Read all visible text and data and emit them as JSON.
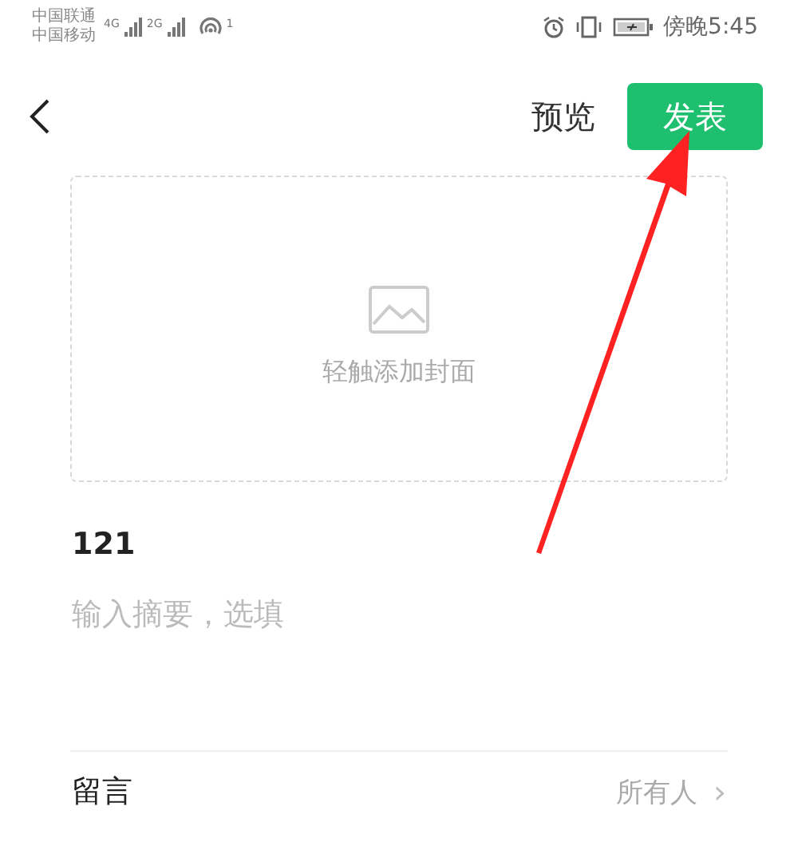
{
  "status_bar": {
    "carriers": [
      "中国联通",
      "中国移动"
    ],
    "networks": [
      "4G",
      "2G"
    ],
    "hotspot_count": "1",
    "time": "傍晚5:45"
  },
  "toolbar": {
    "preview": "预览",
    "publish": "发表"
  },
  "cover": {
    "hint": "轻触添加封面"
  },
  "title": "121",
  "summary": {
    "placeholder": "输入摘要，选填"
  },
  "settings": [
    {
      "label": "留言",
      "value": "所有人",
      "chevron": "›"
    }
  ]
}
